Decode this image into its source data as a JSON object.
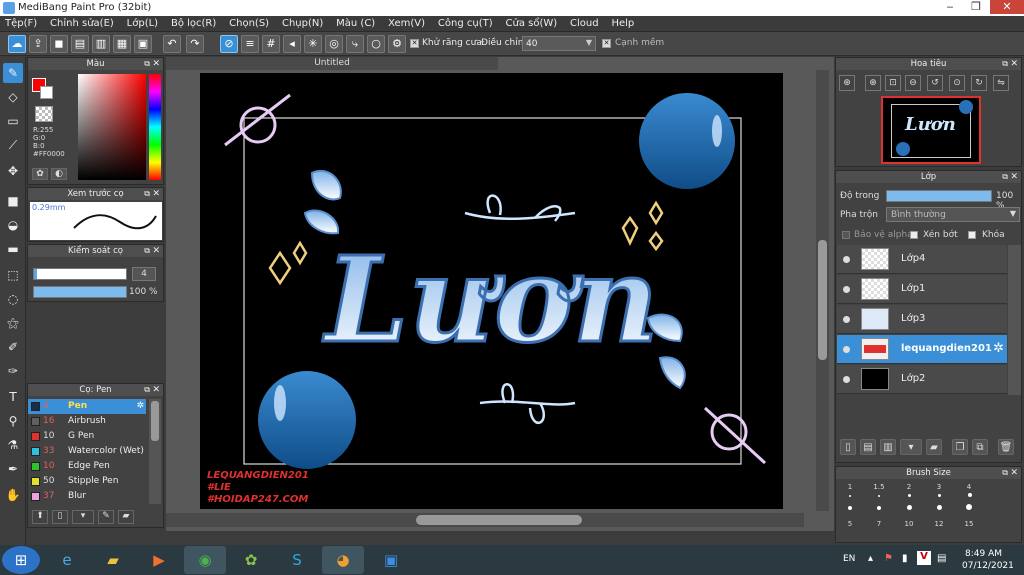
{
  "window": {
    "title": "MediBang Paint Pro (32bit)",
    "minimize": "‒",
    "restore": "❐",
    "close": "✕"
  },
  "menu": [
    "Tệp(F)",
    "Chỉnh sửa(E)",
    "Lớp(L)",
    "Bộ lọc(R)",
    "Chọn(S)",
    "Chụp(N)",
    "Màu (C)",
    "Xem(V)",
    "Công cụ(T)",
    "Cửa sổ(W)",
    "Cloud",
    "Help"
  ],
  "toolbar": {
    "antialias_label": "Khử răng cưa",
    "correction_label": "Điều chỉnh",
    "correction_value": "40",
    "snap_label": "Cạnh mềm"
  },
  "color_panel": {
    "title": "Màu",
    "r": "R:255",
    "g": "G:0",
    "b": "B:0",
    "hex": "#FF0000",
    "primary_color": "#ff0000"
  },
  "preview_panel": {
    "title": "Xem trước cọ",
    "size": "0.29mm"
  },
  "brush_control": {
    "title": "Kiểm soát cọ",
    "size_value": "4",
    "opacity_value": "100 %"
  },
  "brush_panel": {
    "title": "Cọ: Pen",
    "items": [
      {
        "num": "4",
        "name": "Pen",
        "color": "#1a2d4a"
      },
      {
        "num": "16",
        "name": "Airbrush",
        "color": "#606060"
      },
      {
        "num": "10",
        "name": "G Pen",
        "color": "#e03030"
      },
      {
        "num": "33",
        "name": "Watercolor (Wet)",
        "color": "#30c0e0"
      },
      {
        "num": "10",
        "name": "Edge Pen",
        "color": "#30c030"
      },
      {
        "num": "50",
        "name": "Stipple Pen",
        "color": "#e0e030"
      },
      {
        "num": "37",
        "name": "Blur",
        "color": "#f0a0e0"
      }
    ]
  },
  "document": {
    "tab": "Untitled",
    "artwork_text": "Lươn",
    "watermark": [
      "LEQUANGDIEN201",
      "#LIE",
      "#HOIDAP247.COM"
    ]
  },
  "navigator": {
    "title": "Hoa tiêu"
  },
  "layer_panel": {
    "title": "Lớp",
    "opacity_label": "Độ trong",
    "opacity_value": "100 %",
    "blend_label": "Pha trộn",
    "blend_value": "Bình thường",
    "protect_alpha": "Bảo vệ alpha",
    "clipping": "Xén bớt",
    "lock": "Khóa",
    "layers": [
      {
        "name": "Lớp4"
      },
      {
        "name": "Lớp1"
      },
      {
        "name": "Lớp3"
      },
      {
        "name": "lequangdien201"
      },
      {
        "name": "Lớp2"
      }
    ]
  },
  "brush_size": {
    "title": "Brush Size",
    "row1": [
      "1",
      "1.5",
      "2",
      "3",
      "4"
    ],
    "row2": [
      "5",
      "7",
      "10",
      "12",
      "15"
    ]
  },
  "taskbar": {
    "lang": "EN",
    "time": "8:49 AM",
    "date": "07/12/2021"
  }
}
